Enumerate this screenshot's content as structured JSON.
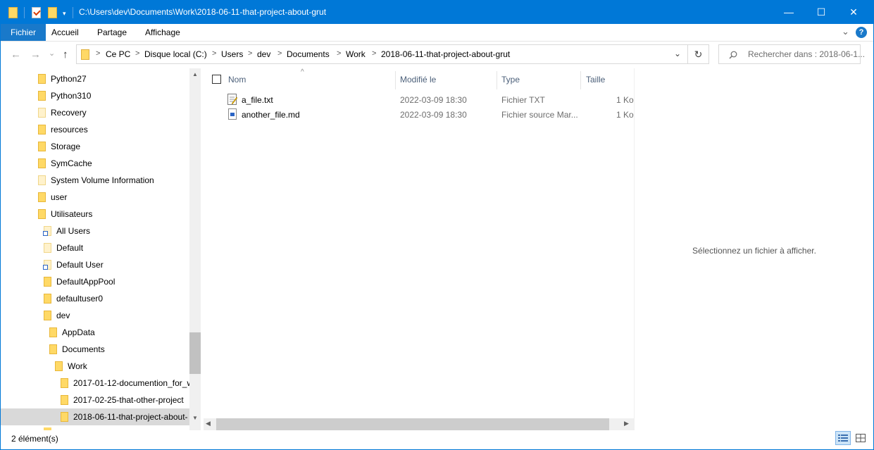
{
  "window": {
    "title": "C:\\Users\\dev\\Documents\\Work\\2018-06-11-that-project-about-grut",
    "minimize_glyph": "—",
    "maximize_glyph": "☐",
    "close_glyph": "✕"
  },
  "ribbon": {
    "tabs": [
      "Fichier",
      "Accueil",
      "Partage",
      "Affichage"
    ],
    "expand_glyph": "⌄",
    "help_glyph": "?"
  },
  "address_bar": {
    "back_glyph": "←",
    "forward_glyph": "→",
    "recent_glyph": "⌄",
    "up_glyph": "↑",
    "crumbs": [
      "Ce PC",
      "Disque local (C:)",
      "Users",
      "dev",
      "Documents",
      "Work",
      "2018-06-11-that-project-about-grut"
    ],
    "separator": ">",
    "dropdown_glyph": "⌄",
    "refresh_glyph": "↻"
  },
  "search": {
    "placeholder": "Rechercher dans : 2018-06-1..."
  },
  "nav_tree": {
    "items": [
      {
        "label": "Python27"
      },
      {
        "label": "Python310"
      },
      {
        "label": "Recovery"
      },
      {
        "label": "resources"
      },
      {
        "label": "Storage"
      },
      {
        "label": "SymCache"
      },
      {
        "label": "System Volume Information"
      },
      {
        "label": "user"
      },
      {
        "label": "Utilisateurs"
      },
      {
        "label": "All Users"
      },
      {
        "label": "Default"
      },
      {
        "label": "Default User"
      },
      {
        "label": "DefaultAppPool"
      },
      {
        "label": "defaultuser0"
      },
      {
        "label": "dev"
      },
      {
        "label": "AppData"
      },
      {
        "label": "Documents"
      },
      {
        "label": "Work"
      },
      {
        "label": "2017-01-12-documention_for_w"
      },
      {
        "label": "2017-02-25-that-other-project"
      },
      {
        "label": "2018-06-11-that-project-about-"
      }
    ]
  },
  "file_list": {
    "columns": {
      "name": "Nom",
      "modified": "Modifié le",
      "type": "Type",
      "size": "Taille"
    },
    "sort_glyph": "^",
    "rows": [
      {
        "name": "a_file.txt",
        "modified": "2022-03-09 18:30",
        "type": "Fichier TXT",
        "size": "1 Ko",
        "icon": "text-file-icon"
      },
      {
        "name": "another_file.md",
        "modified": "2022-03-09 18:30",
        "type": "Fichier source Mar...",
        "size": "1 Ko",
        "icon": "markdown-file-icon"
      }
    ]
  },
  "preview": {
    "message": "Sélectionnez un fichier à afficher."
  },
  "status_bar": {
    "text": "2 élément(s)"
  }
}
